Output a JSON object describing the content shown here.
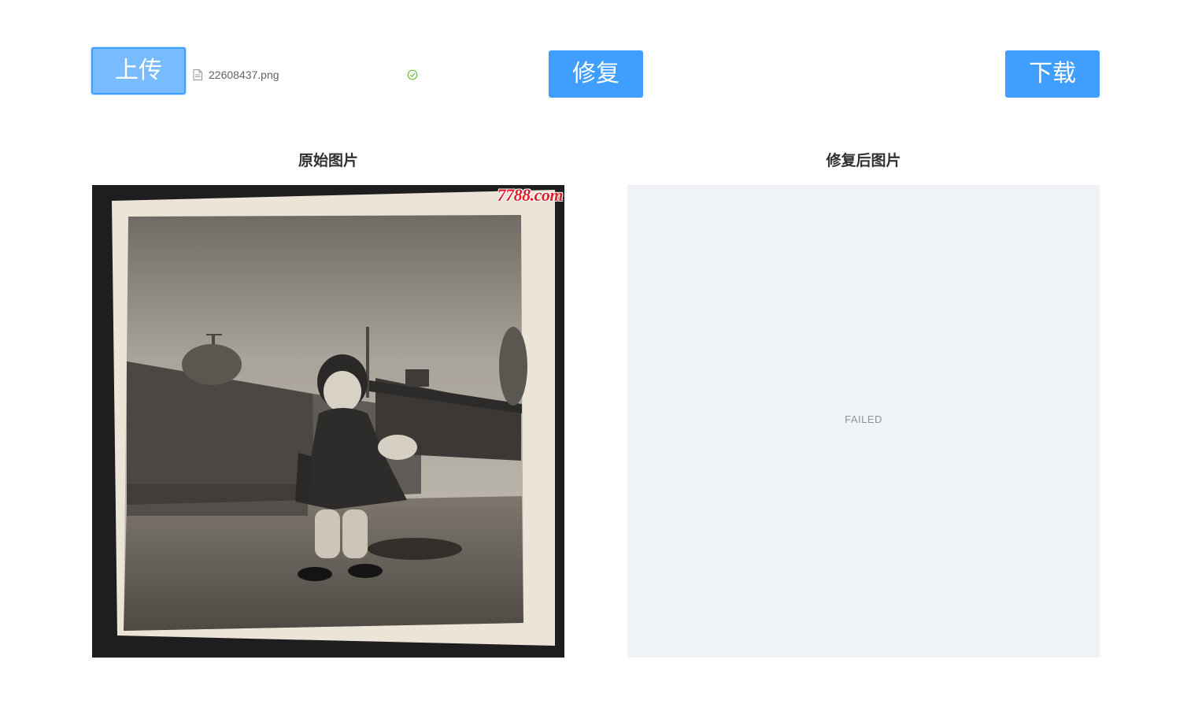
{
  "toolbar": {
    "upload_label": "上传",
    "repair_label": "修复",
    "download_label": "下载"
  },
  "upload": {
    "file_name": "22608437.png",
    "file_icon": "document-icon",
    "status_icon": "circle-check-icon",
    "status_color": "#67c23a"
  },
  "panels": {
    "original_title": "原始图片",
    "repaired_title": "修复后图片",
    "repaired_status": "FAILED"
  },
  "original_image": {
    "description_icon": "old-photo-child-standing",
    "watermark_text": "7788.com"
  },
  "colors": {
    "primary": "#409eff",
    "primary_light": "#79bbff",
    "placeholder_bg": "#eff3f7"
  }
}
